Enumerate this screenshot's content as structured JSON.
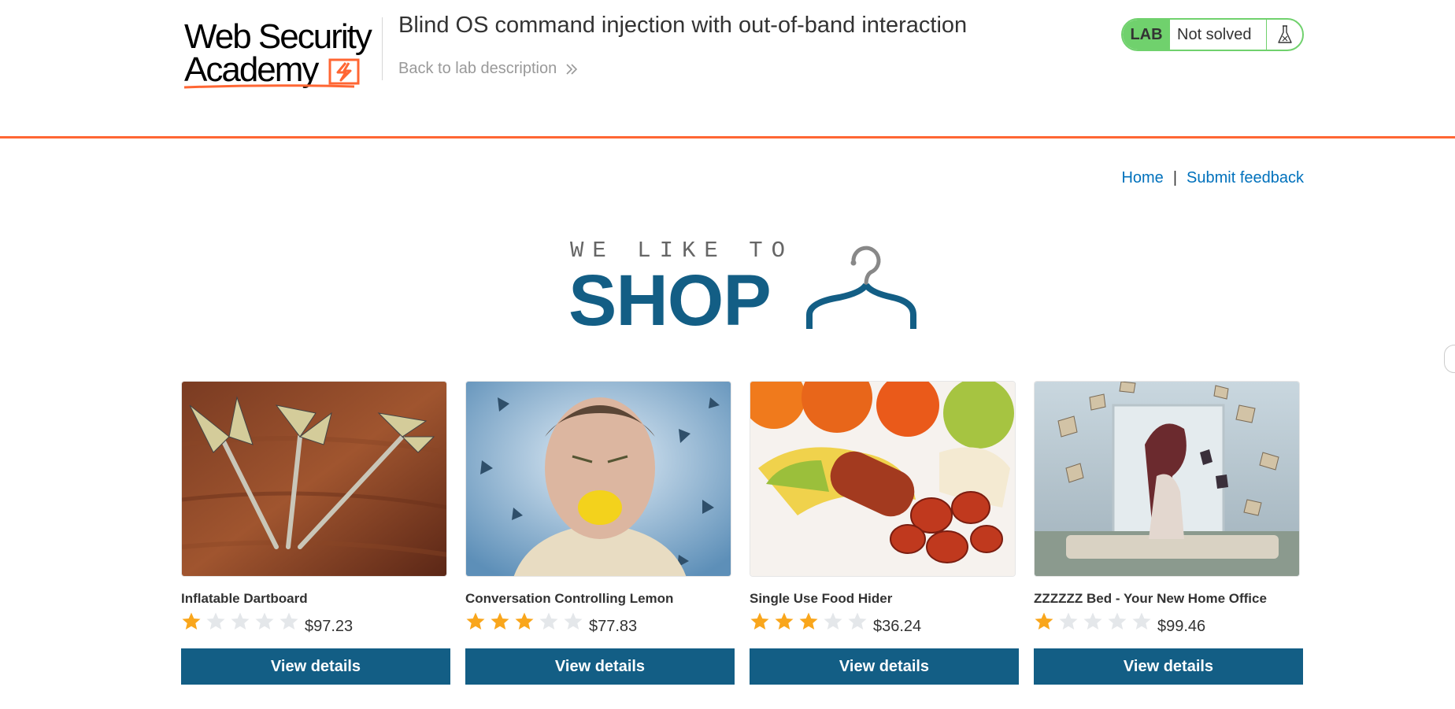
{
  "header": {
    "logo_line1": "Web Security",
    "logo_line2": "Academy",
    "lab_title": "Blind OS command injection with out-of-band interaction",
    "back_link_label": "Back to lab description",
    "status_badge": "LAB",
    "status_text": "Not solved",
    "status_icon": "flask-icon"
  },
  "nav": {
    "home_label": "Home",
    "separator": "|",
    "feedback_label": "Submit feedback"
  },
  "banner": {
    "small_text": "WE LIKE TO",
    "big_text": "SHOP",
    "icon": "hanger-icon"
  },
  "products": [
    {
      "name": "Inflatable Dartboard",
      "rating": 1,
      "price": "$97.23",
      "button_label": "View details",
      "image": "darts-image"
    },
    {
      "name": "Conversation Controlling Lemon",
      "rating": 3,
      "price": "$77.83",
      "button_label": "View details",
      "image": "lemon-man-image"
    },
    {
      "name": "Single Use Food Hider",
      "rating": 3,
      "price": "$36.24",
      "button_label": "View details",
      "image": "food-hider-image"
    },
    {
      "name": "ZZZZZZ Bed - Your New Home Office",
      "rating": 1,
      "price": "$99.46",
      "button_label": "View details",
      "image": "floating-books-image"
    }
  ],
  "colors": {
    "accent_orange": "#ff6633",
    "brand_blue": "#135e85",
    "link_blue": "#0071bc",
    "status_green": "#70d16d",
    "star_filled": "#f9a61c",
    "star_empty": "#e4e7ea"
  }
}
